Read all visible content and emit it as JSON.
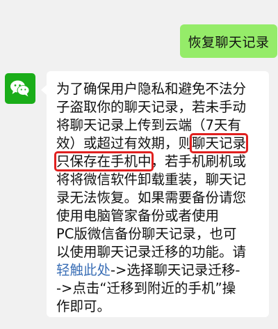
{
  "outgoing": {
    "text": "恢复聊天记录"
  },
  "incoming": {
    "avatar_icon": "wechat-logo-icon",
    "lines": {
      "l1": "为了确保用户隐私和避免不法分",
      "l2": "子盗取你的聊天记录，若未手动",
      "l3": "将聊天记录上传到云端（7天有",
      "l4a": "效）或超过有效期，则",
      "l4b": "聊天记录",
      "l5a": "只保存在手机中",
      "l5b": "，若手机刷机或",
      "l6": "将将微信软件卸载重装，聊天记",
      "l7": "录无法恢复。如果需要备份请您",
      "l8": "使用电脑管家备份或者使用",
      "l9": "PC版微信备份聊天记录，也可",
      "l10": "以使用聊天记录迁移的功能。请",
      "l11a": "轻触此处",
      "l11b": "->选择聊天记录迁移-",
      "l12": "->点击“迁移到附近的手机”操",
      "l13": "作即可。"
    }
  },
  "colors": {
    "background": "#f1f1f1",
    "outgoing_bubble": "#95ec69",
    "incoming_bubble": "#ffffff",
    "avatar": "#1aad19",
    "link": "#3b6fb6",
    "highlight_box": "#e0201f"
  }
}
